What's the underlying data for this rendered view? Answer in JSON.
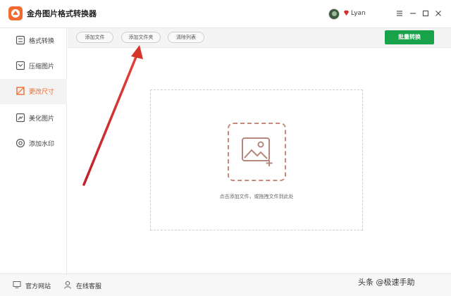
{
  "app": {
    "title": "金舟图片格式转换器",
    "user": {
      "name": "Lyan"
    }
  },
  "sidebar": {
    "items": [
      {
        "label": "格式转换",
        "icon": "format-convert-icon",
        "active": false
      },
      {
        "label": "压缩图片",
        "icon": "compress-icon",
        "active": false
      },
      {
        "label": "更改尺寸",
        "icon": "resize-icon",
        "active": true
      },
      {
        "label": "美化图片",
        "icon": "beautify-icon",
        "active": false
      },
      {
        "label": "添加水印",
        "icon": "watermark-icon",
        "active": false
      }
    ]
  },
  "toolbar": {
    "add_file": "添加文件",
    "add_folder": "添加文件夹",
    "clear_list": "清除列表",
    "batch_convert": "批量转换"
  },
  "drop_zone": {
    "hint": "点击添加文件，或拖拽文件到此处"
  },
  "footer": {
    "official_site": "官方网站",
    "online_service": "在线客服"
  },
  "watermark": {
    "text": "头条 @极速手助"
  },
  "colors": {
    "accent": "#f06a2c",
    "primary_button": "#18a34a",
    "annotation_arrow": "#d9342b"
  }
}
